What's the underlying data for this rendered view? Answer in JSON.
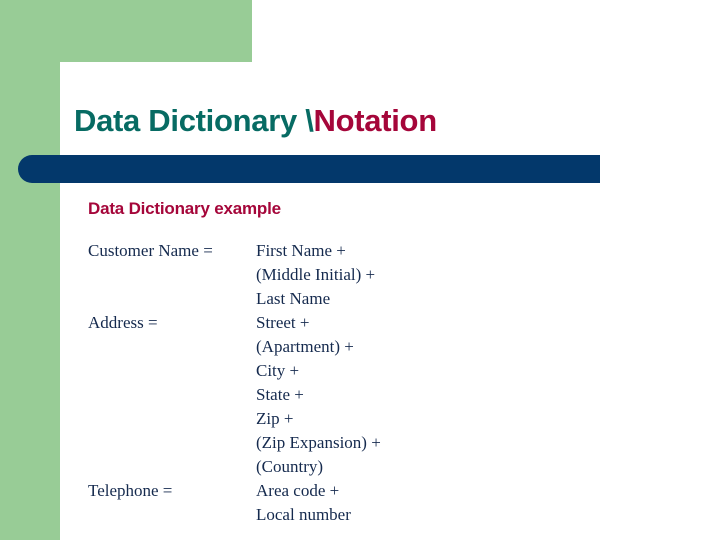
{
  "slide": {
    "title_main": "Data Dictionary \\",
    "title_accent": "Notation",
    "subtitle": "Data Dictionary example",
    "colors": {
      "green": "#98cc96",
      "navy_bar": "#03386b",
      "title_teal": "#076b63",
      "accent_crimson": "#a5063a",
      "body_text": "#152a4e",
      "panel": "#ffffff"
    },
    "dictionary": [
      {
        "term": "Customer Name =",
        "definition": "First Name +"
      },
      {
        "term": "",
        "definition": "(Middle Initial) +"
      },
      {
        "term": "",
        "definition": "Last Name"
      },
      {
        "term": "Address =",
        "definition": "Street +"
      },
      {
        "term": "",
        "definition": "(Apartment) +"
      },
      {
        "term": "",
        "definition": "City +"
      },
      {
        "term": "",
        "definition": "State +"
      },
      {
        "term": "",
        "definition": "Zip +"
      },
      {
        "term": "",
        "definition": "(Zip Expansion) +"
      },
      {
        "term": "",
        "definition": "(Country)"
      },
      {
        "term": "Telephone =",
        "definition": "Area code +"
      },
      {
        "term": "",
        "definition": "Local number"
      }
    ]
  }
}
